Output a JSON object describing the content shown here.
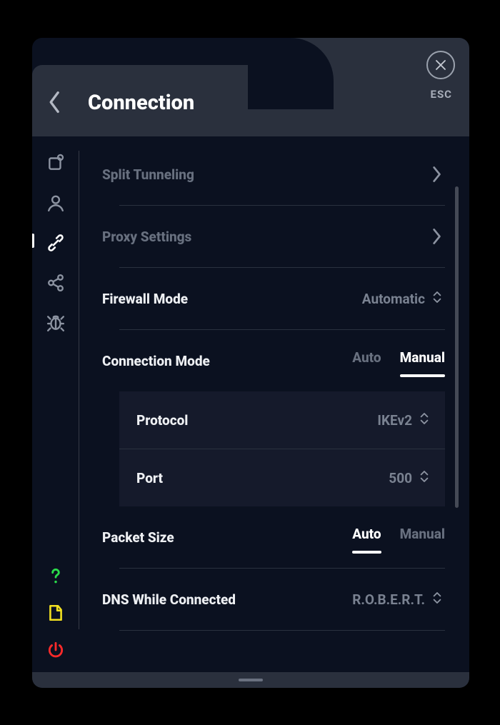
{
  "header": {
    "title": "Connection",
    "esc_label": "ESC"
  },
  "sidebar": {
    "top_icons": [
      "general-icon",
      "account-icon",
      "connection-icon",
      "share-icon",
      "debug-icon"
    ],
    "active_index": 2,
    "bottom_icons": [
      "help-icon",
      "plan-icon",
      "power-icon"
    ]
  },
  "settings": {
    "split_tunneling": {
      "label": "Split Tunneling"
    },
    "proxy": {
      "label": "Proxy Settings"
    },
    "firewall": {
      "label": "Firewall Mode",
      "value": "Automatic"
    },
    "conn_mode": {
      "label": "Connection Mode",
      "opts": {
        "auto": "Auto",
        "manual": "Manual"
      },
      "selected": "manual",
      "protocol": {
        "label": "Protocol",
        "value": "IKEv2"
      },
      "port": {
        "label": "Port",
        "value": "500"
      }
    },
    "packet": {
      "label": "Packet Size",
      "opts": {
        "auto": "Auto",
        "manual": "Manual"
      },
      "selected": "auto"
    },
    "dns": {
      "label": "DNS While Connected",
      "value": "R.O.B.E.R.T."
    }
  }
}
